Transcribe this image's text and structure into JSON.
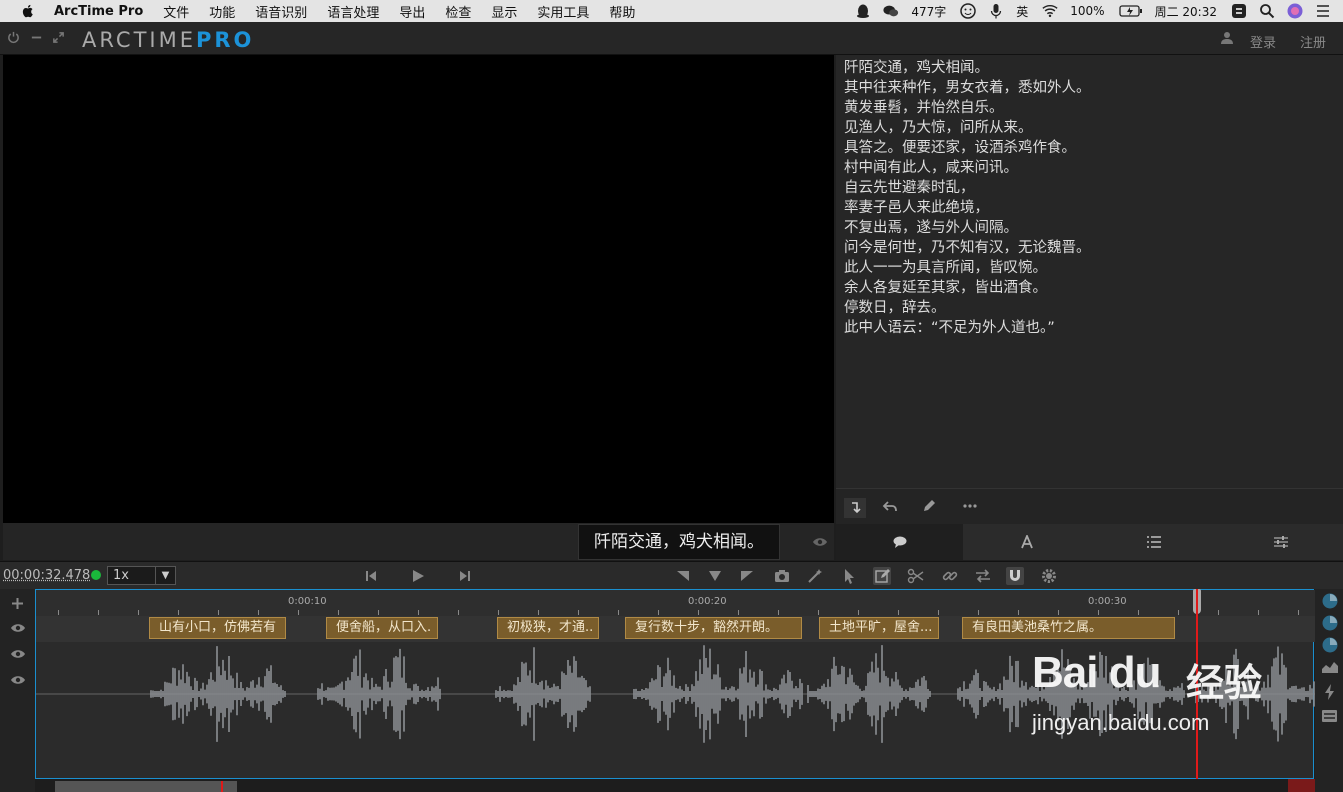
{
  "menubar": {
    "app_name": "ArcTime Pro",
    "items": [
      "文件",
      "功能",
      "语音识别",
      "语言处理",
      "导出",
      "检查",
      "显示",
      "实用工具",
      "帮助"
    ],
    "status": {
      "word_count": "477字",
      "input_method": "英",
      "battery": "100%",
      "clock": "周二 20:32"
    }
  },
  "toolbar": {
    "logo_main": "ARCTIME",
    "logo_pro": "PRO",
    "login_label": "登录",
    "register_label": "注册",
    "accent_color": "#1c92d8"
  },
  "script_lines": [
    "阡陌交通，鸡犬相闻。",
    "其中往来种作，男女衣着，悉如外人。",
    "黄发垂髫，并怡然自乐。",
    "见渔人，乃大惊，问所从来。",
    "具答之。便要还家，设酒杀鸡作食。",
    "村中闻有此人，咸来问讯。",
    "自云先世避秦时乱，",
    "率妻子邑人来此绝境，",
    "不复出焉，遂与外人间隔。",
    "问今是何世，乃不知有汉，无论魏晋。",
    "此人一一为具言所闻，皆叹惋。",
    "余人各复延至其家，皆出酒食。",
    "停数日，辞去。",
    "此中人语云：“不足为外人道也。”"
  ],
  "video": {
    "subtitle_preview": "阡陌交通，鸡犬相闻。"
  },
  "transport": {
    "timecode": "00:00:32.478",
    "speed": "1x",
    "speed_caret": "▼"
  },
  "timeline": {
    "ruler_labels": [
      "0:00:10",
      "0:00:20",
      "0:00:30"
    ],
    "clips": [
      {
        "text": "山有小口，仿佛若有"
      },
      {
        "text": "便舍船，从口入."
      },
      {
        "text": "初极狭，才通.."
      },
      {
        "text": "复行数十步，豁然开朗。"
      },
      {
        "text": "土地平旷，屋舍..."
      },
      {
        "text": "有良田美池桑竹之属。"
      }
    ],
    "playhead_time": "00:00:32.478",
    "clip_color": "#7a5d2b",
    "playhead_color": "#e01a1a"
  },
  "watermark": {
    "logo": "Bai du",
    "cn": "经验",
    "url": "jingyan.baidu.com"
  }
}
